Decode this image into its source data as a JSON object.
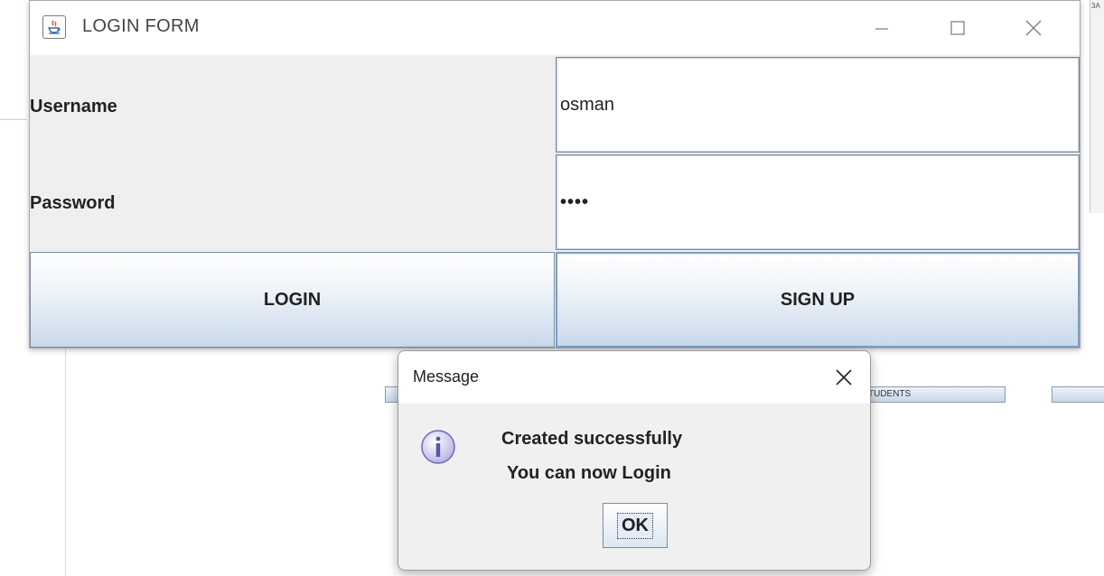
{
  "login_window": {
    "title": "LOGIN FORM",
    "username_label": "Username",
    "password_label": "Password",
    "username_value": "osman",
    "password_value": "••••",
    "login_button": "LOGIN",
    "signup_button": "SIGN UP"
  },
  "background": {
    "button_students": "TUDENTS",
    "corner_text": "3A"
  },
  "message_dialog": {
    "title": "Message",
    "line1": "Created successfully",
    "line2": "You can now Login",
    "ok_button": "OK"
  }
}
